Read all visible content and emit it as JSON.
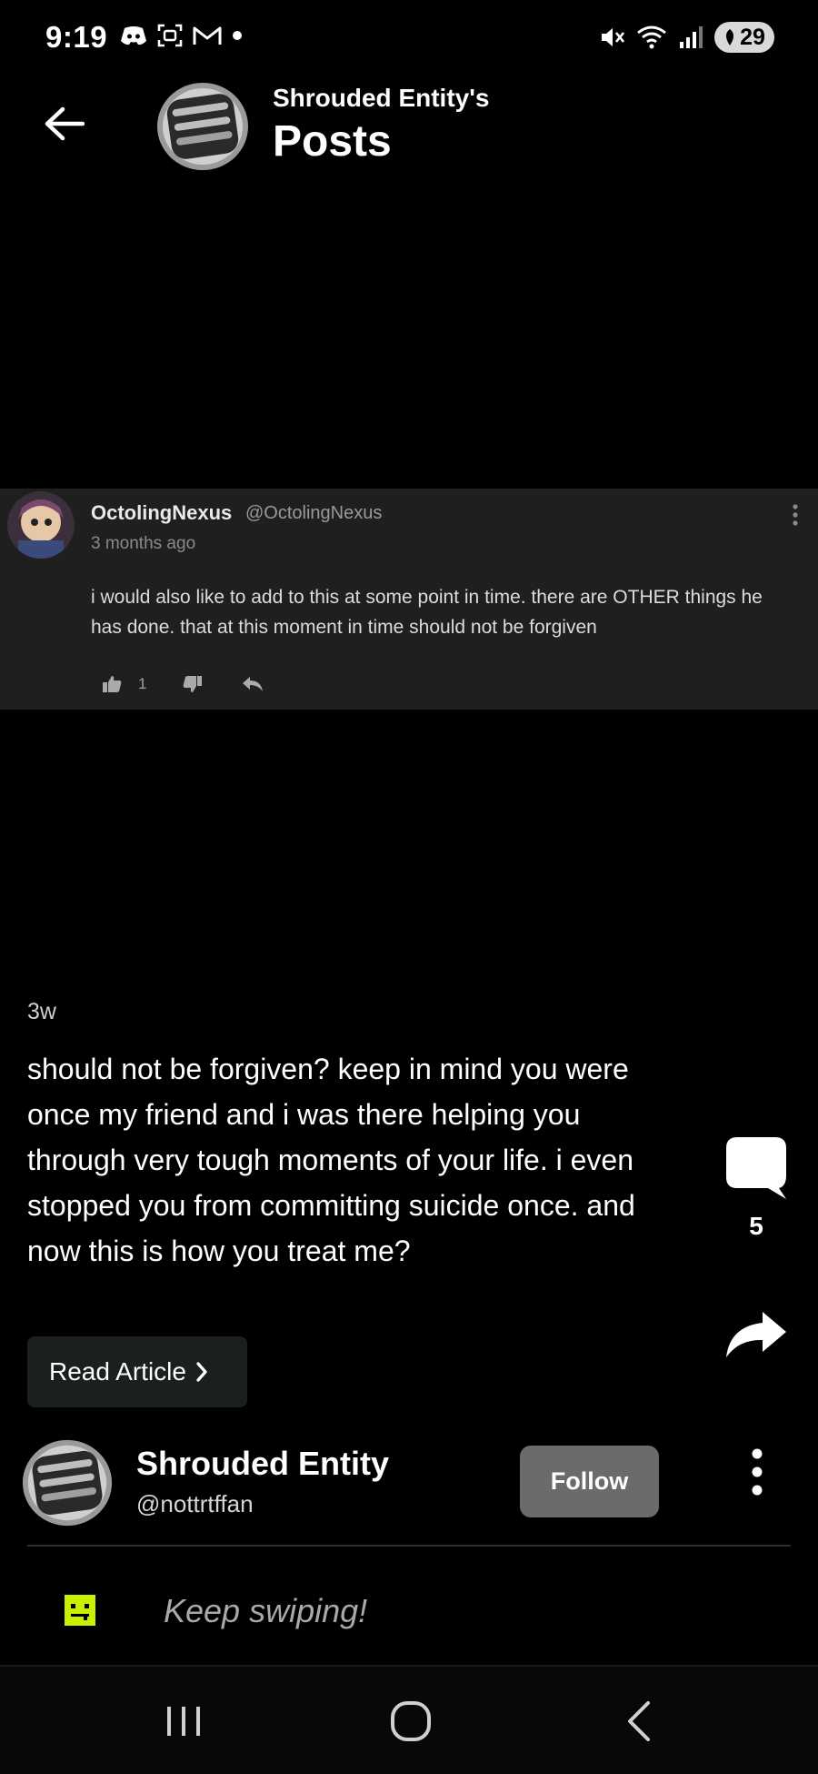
{
  "status_bar": {
    "time": "9:19",
    "battery": "29",
    "left_icons": [
      "discord-icon",
      "screenshot-icon",
      "gmail-icon",
      "dot-icon"
    ],
    "right_icons": [
      "mute-icon",
      "wifi-icon",
      "signal-icon",
      "battery-icon"
    ]
  },
  "header": {
    "subtitle": "Shrouded Entity's",
    "title": "Posts"
  },
  "embedded_comment": {
    "author": "OctolingNexus",
    "handle": "@OctolingNexus",
    "time": "3 months ago",
    "text": "i would also like to add to this at some point in time. there are OTHER things he has done. that at this moment in time should not be forgiven",
    "likes": "1"
  },
  "post": {
    "age": "3w",
    "body": "should not be forgiven? keep in mind you were once my friend and i was there helping you through very tough moments of your life. i even stopped you from committing suicide once. and now this is how you treat me?",
    "read_article_label": "Read Article",
    "comment_count": "5"
  },
  "author": {
    "name": "Shrouded Entity",
    "handle": "@nottrtffan",
    "follow_label": "Follow"
  },
  "hint": {
    "text": "Keep swiping!"
  },
  "colors": {
    "background": "#000000",
    "comment_card": "#1f1f1f",
    "follow_button": "#6b6b6b",
    "hint_icon": "#c8f000"
  }
}
